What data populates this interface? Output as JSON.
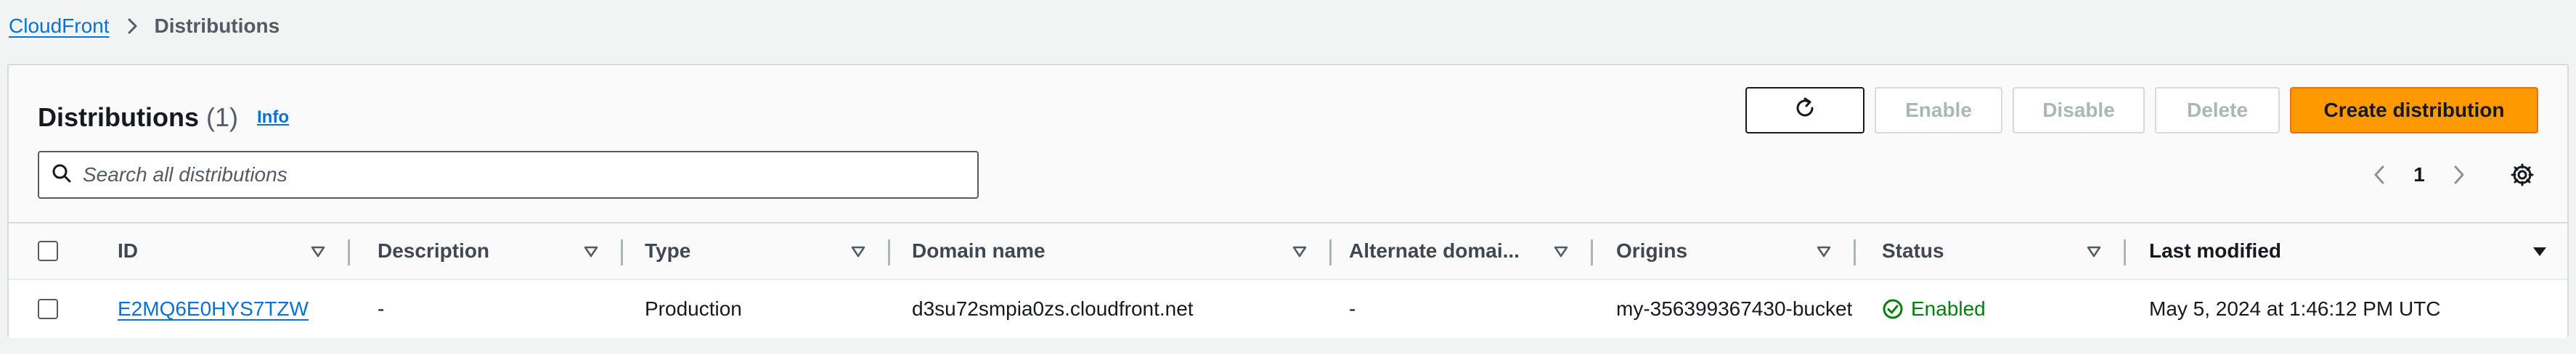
{
  "breadcrumb": {
    "root": "CloudFront",
    "current": "Distributions"
  },
  "header": {
    "title": "Distributions",
    "count": "(1)",
    "info": "Info"
  },
  "actions": {
    "enable": "Enable",
    "disable": "Disable",
    "delete": "Delete",
    "create": "Create distribution"
  },
  "search": {
    "placeholder": "Search all distributions"
  },
  "pagination": {
    "current_page": "1"
  },
  "table": {
    "columns": [
      "ID",
      "Description",
      "Type",
      "Domain name",
      "Alternate domai...",
      "Origins",
      "Status",
      "Last modified"
    ],
    "rows": [
      {
        "id": "E2MQ6E0HYS7TZW",
        "description": "-",
        "type": "Production",
        "domain_name": "d3su72smpia0zs.cloudfront.net",
        "alternate_domain": "-",
        "origins": "my-356399367430-bucket",
        "status": "Enabled",
        "last_modified": "May 5, 2024 at 1:46:12 PM UTC"
      }
    ]
  },
  "colors": {
    "link": "#0972d3",
    "primary": "#ff9900",
    "success": "#037f0c",
    "disabled_text": "#aab7b8"
  },
  "icons": [
    "chevron-right-icon",
    "refresh-icon",
    "search-icon",
    "chevron-left-icon",
    "settings-icon",
    "sort-icon",
    "sort-desc-icon",
    "status-check-icon"
  ]
}
